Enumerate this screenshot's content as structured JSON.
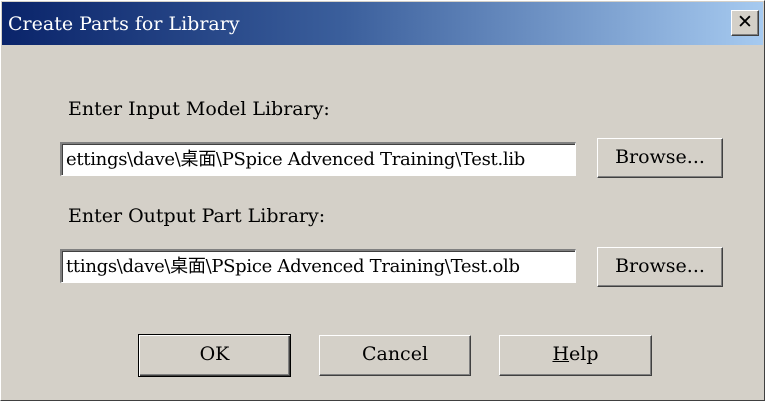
{
  "window": {
    "title": "Create Parts for Library",
    "close_glyph": "✕"
  },
  "input_library": {
    "label": "Enter Input Model Library:",
    "value": "ettings\\dave\\桌面\\PSpice Advenced Training\\Test.lib",
    "browse_label": "Browse..."
  },
  "output_library": {
    "label": "Enter Output Part Library:",
    "value": "ttings\\dave\\桌面\\PSpice Advenced Training\\Test.olb",
    "browse_label": "Browse..."
  },
  "buttons": {
    "ok": "OK",
    "cancel": "Cancel",
    "help_mnemonic": "H",
    "help_rest": "elp"
  },
  "colors": {
    "dialog_face": "#d4d0c8",
    "title_gradient_start": "#0a246a",
    "title_gradient_end": "#a6caf0"
  }
}
